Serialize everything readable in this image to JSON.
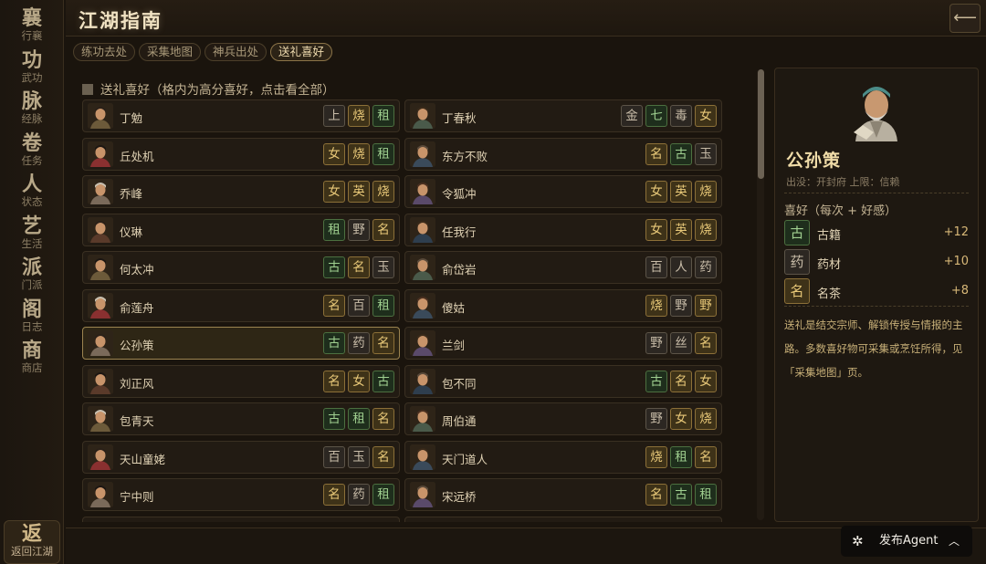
{
  "nav": {
    "items": [
      {
        "glyph": "襄",
        "label": "行襄"
      },
      {
        "glyph": "功",
        "label": "武功"
      },
      {
        "glyph": "脉",
        "label": "经脉"
      },
      {
        "glyph": "卷",
        "label": "任务"
      },
      {
        "glyph": "人",
        "label": "状态"
      },
      {
        "glyph": "艺",
        "label": "生活"
      },
      {
        "glyph": "派",
        "label": "门派"
      },
      {
        "glyph": "阁",
        "label": "日志"
      },
      {
        "glyph": "商",
        "label": "商店"
      }
    ],
    "back": {
      "glyph": "返",
      "label": "返回江湖"
    }
  },
  "header": {
    "title": "江湖指南",
    "back_icon": "arrow-left"
  },
  "tabs": [
    {
      "label": "练功去处",
      "active": false
    },
    {
      "label": "采集地图",
      "active": false
    },
    {
      "label": "神兵出处",
      "active": false
    },
    {
      "label": "送礼喜好",
      "active": true
    }
  ],
  "section": {
    "title": "送礼喜好（格内为高分喜好，点击看全部）"
  },
  "colors": {
    "gold": "#e8c878",
    "green": "#a0d090",
    "gray": "#c8bca8",
    "accent": "#9c8450"
  },
  "characters": [
    {
      "name": "丁勉",
      "tags": [
        {
          "t": "上",
          "c": "gray"
        },
        {
          "t": "烧",
          "c": "gold"
        },
        {
          "t": "租",
          "c": "green"
        }
      ]
    },
    {
      "name": "丁春秋",
      "tags": [
        {
          "t": "金",
          "c": "gray"
        },
        {
          "t": "七",
          "c": "green"
        },
        {
          "t": "毒",
          "c": "gray"
        },
        {
          "t": "女",
          "c": "gold"
        }
      ]
    },
    {
      "name": "丘处机",
      "tags": [
        {
          "t": "女",
          "c": "gold"
        },
        {
          "t": "烧",
          "c": "gold"
        },
        {
          "t": "租",
          "c": "green"
        }
      ]
    },
    {
      "name": "东方不败",
      "tags": [
        {
          "t": "名",
          "c": "gold"
        },
        {
          "t": "古",
          "c": "green"
        },
        {
          "t": "玉",
          "c": "gray"
        }
      ]
    },
    {
      "name": "乔峰",
      "tags": [
        {
          "t": "女",
          "c": "gold"
        },
        {
          "t": "英",
          "c": "gold"
        },
        {
          "t": "烧",
          "c": "gold"
        }
      ]
    },
    {
      "name": "令狐冲",
      "tags": [
        {
          "t": "女",
          "c": "gold"
        },
        {
          "t": "英",
          "c": "gold"
        },
        {
          "t": "烧",
          "c": "gold"
        }
      ]
    },
    {
      "name": "仪琳",
      "tags": [
        {
          "t": "租",
          "c": "green"
        },
        {
          "t": "野",
          "c": "gray"
        },
        {
          "t": "名",
          "c": "gold"
        }
      ]
    },
    {
      "name": "任我行",
      "tags": [
        {
          "t": "女",
          "c": "gold"
        },
        {
          "t": "英",
          "c": "gold"
        },
        {
          "t": "烧",
          "c": "gold"
        }
      ]
    },
    {
      "name": "何太冲",
      "tags": [
        {
          "t": "古",
          "c": "green"
        },
        {
          "t": "名",
          "c": "gold"
        },
        {
          "t": "玉",
          "c": "gray"
        }
      ]
    },
    {
      "name": "俞岱岩",
      "tags": [
        {
          "t": "百",
          "c": "gray"
        },
        {
          "t": "人",
          "c": "gray"
        },
        {
          "t": "药",
          "c": "gray"
        }
      ]
    },
    {
      "name": "俞莲舟",
      "tags": [
        {
          "t": "名",
          "c": "gold"
        },
        {
          "t": "百",
          "c": "gray"
        },
        {
          "t": "租",
          "c": "green"
        }
      ]
    },
    {
      "name": "傻姑",
      "tags": [
        {
          "t": "烧",
          "c": "gold"
        },
        {
          "t": "野",
          "c": "gray"
        },
        {
          "t": "野",
          "c": "gold"
        }
      ]
    },
    {
      "name": "公孙策",
      "selected": true,
      "tags": [
        {
          "t": "古",
          "c": "green"
        },
        {
          "t": "药",
          "c": "gray"
        },
        {
          "t": "名",
          "c": "gold"
        }
      ]
    },
    {
      "name": "兰剑",
      "tags": [
        {
          "t": "野",
          "c": "gray"
        },
        {
          "t": "丝",
          "c": "gray"
        },
        {
          "t": "名",
          "c": "gold"
        }
      ]
    },
    {
      "name": "刘正风",
      "tags": [
        {
          "t": "名",
          "c": "gold"
        },
        {
          "t": "女",
          "c": "gold"
        },
        {
          "t": "古",
          "c": "green"
        }
      ]
    },
    {
      "name": "包不同",
      "tags": [
        {
          "t": "古",
          "c": "green"
        },
        {
          "t": "名",
          "c": "gold"
        },
        {
          "t": "女",
          "c": "gold"
        }
      ]
    },
    {
      "name": "包青天",
      "tags": [
        {
          "t": "古",
          "c": "green"
        },
        {
          "t": "租",
          "c": "green"
        },
        {
          "t": "名",
          "c": "gold"
        }
      ]
    },
    {
      "name": "周伯通",
      "tags": [
        {
          "t": "野",
          "c": "gray"
        },
        {
          "t": "女",
          "c": "gold"
        },
        {
          "t": "烧",
          "c": "gold"
        }
      ]
    },
    {
      "name": "天山童姥",
      "tags": [
        {
          "t": "百",
          "c": "gray"
        },
        {
          "t": "玉",
          "c": "gray"
        },
        {
          "t": "名",
          "c": "gold"
        }
      ]
    },
    {
      "name": "天门道人",
      "tags": [
        {
          "t": "烧",
          "c": "gold"
        },
        {
          "t": "租",
          "c": "green"
        },
        {
          "t": "名",
          "c": "gold"
        }
      ]
    },
    {
      "name": "宁中则",
      "tags": [
        {
          "t": "名",
          "c": "gold"
        },
        {
          "t": "药",
          "c": "gray"
        },
        {
          "t": "租",
          "c": "green"
        }
      ]
    },
    {
      "name": "宋远桥",
      "tags": [
        {
          "t": "名",
          "c": "gold"
        },
        {
          "t": "古",
          "c": "green"
        },
        {
          "t": "租",
          "c": "green"
        }
      ]
    }
  ],
  "detail": {
    "name": "公孙策",
    "sub": "出没：开封府   上限：信赖",
    "pref_title": "喜好（每次 + 好感）",
    "prefs": [
      {
        "tag": "古",
        "c": "green",
        "name": "古籍",
        "value": "+12"
      },
      {
        "tag": "药",
        "c": "gray",
        "name": "药材",
        "value": "+10"
      },
      {
        "tag": "名",
        "c": "gold",
        "name": "名茶",
        "value": "+8"
      }
    ],
    "note": "送礼是结交宗师、解锁传授与情报的主路。多数喜好物可采集或烹饪所得，见「采集地图」页。"
  },
  "agent": {
    "label": "发布Agent"
  }
}
